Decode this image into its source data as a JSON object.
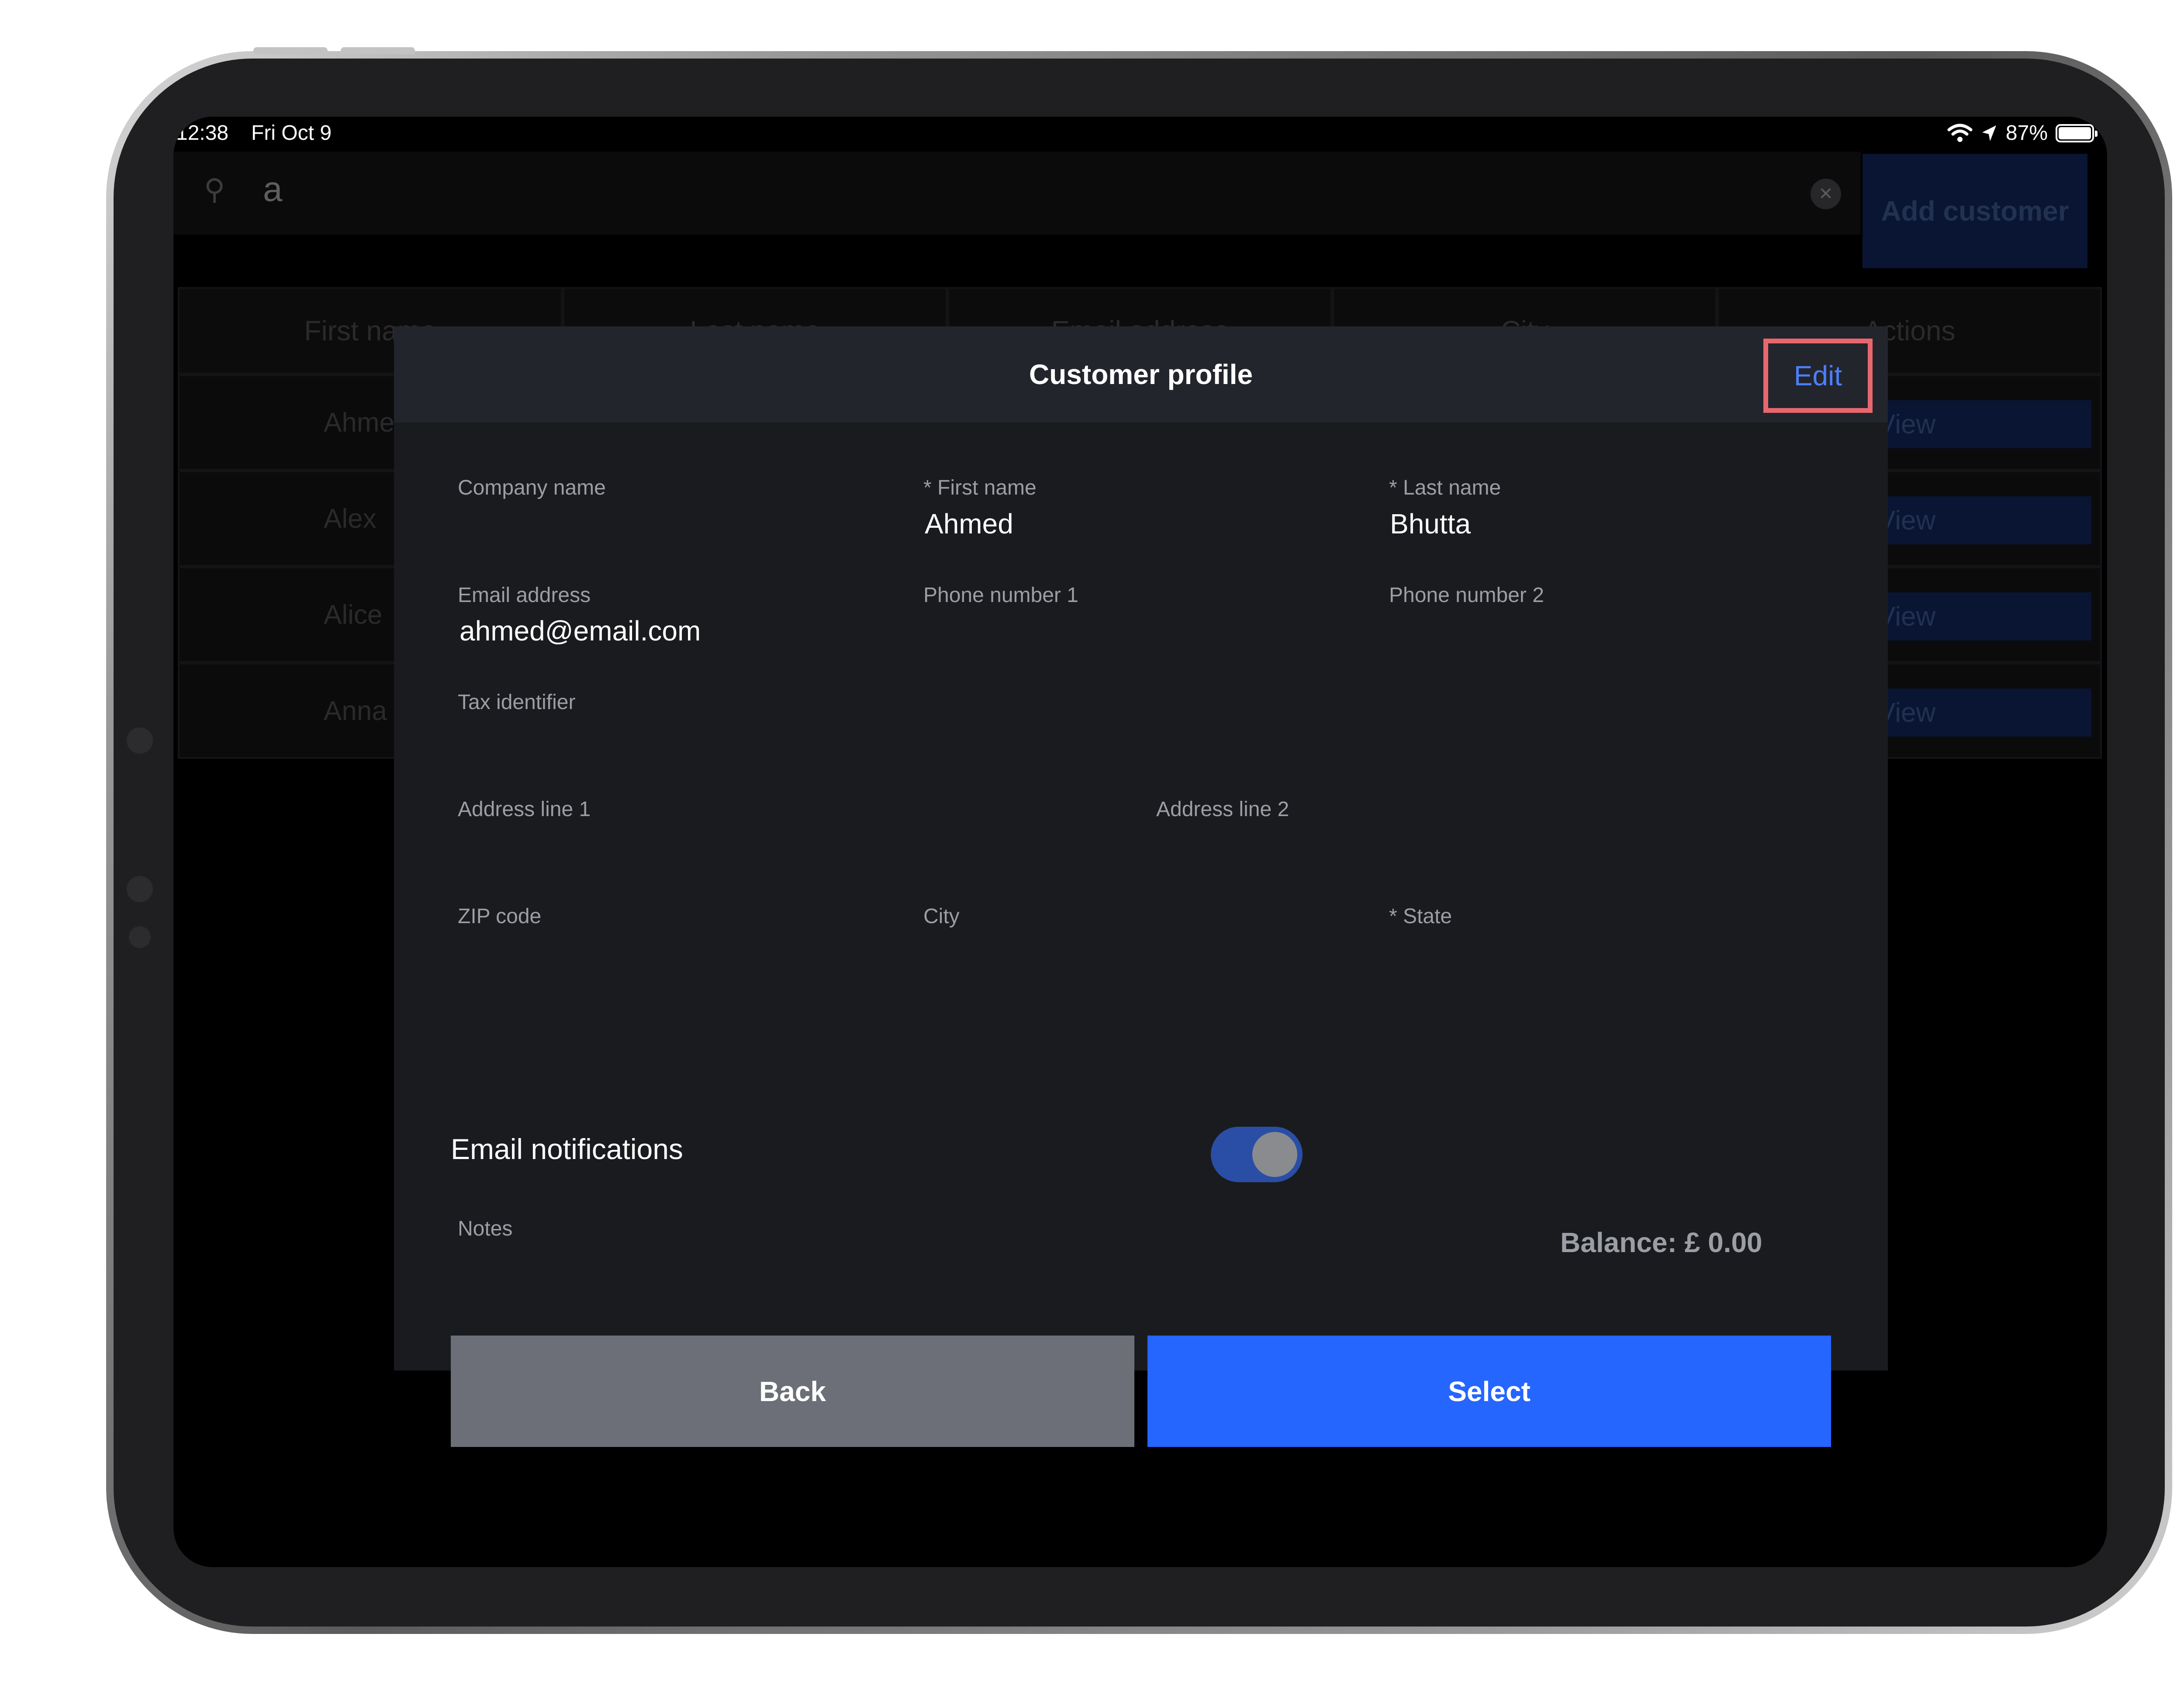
{
  "status_bar": {
    "time": "12:38",
    "date": "Fri Oct 9",
    "battery": "87%"
  },
  "background": {
    "search_query": "a",
    "add_customer_label": "Add customer",
    "columns": [
      "First name",
      "Last name",
      "Email address",
      "City",
      "Actions"
    ],
    "rows": [
      {
        "first": "Ahme",
        "action": "View"
      },
      {
        "first": "Alex",
        "action": "View"
      },
      {
        "first": "Alice",
        "action": "View"
      },
      {
        "first": "Anna",
        "action": "View"
      }
    ]
  },
  "modal": {
    "title": "Customer profile",
    "edit_label": "Edit",
    "fields": {
      "company_name": {
        "label": "Company name",
        "value": ""
      },
      "first_name": {
        "label": "* First name",
        "value": "Ahmed"
      },
      "last_name": {
        "label": "* Last name",
        "value": "Bhutta"
      },
      "email": {
        "label": "Email address",
        "value": "ahmed@email.com"
      },
      "phone1": {
        "label": "Phone number 1",
        "value": ""
      },
      "phone2": {
        "label": "Phone number 2",
        "value": ""
      },
      "tax_id": {
        "label": "Tax identifier",
        "value": ""
      },
      "address1": {
        "label": "Address line 1",
        "value": ""
      },
      "address2": {
        "label": "Address line 2",
        "value": ""
      },
      "zip": {
        "label": "ZIP code",
        "value": ""
      },
      "city": {
        "label": "City",
        "value": ""
      },
      "state": {
        "label": "* State",
        "value": ""
      },
      "notes": {
        "label": "Notes",
        "value": ""
      }
    },
    "email_notifications": {
      "label": "Email notifications",
      "enabled": true
    },
    "balance": "Balance: £ 0.00",
    "back_label": "Back",
    "select_label": "Select"
  },
  "colors": {
    "accent_blue": "#2566fe",
    "highlight_border": "#e8676e",
    "modal_bg": "#1a1b1e",
    "header_bg": "#22252c"
  }
}
